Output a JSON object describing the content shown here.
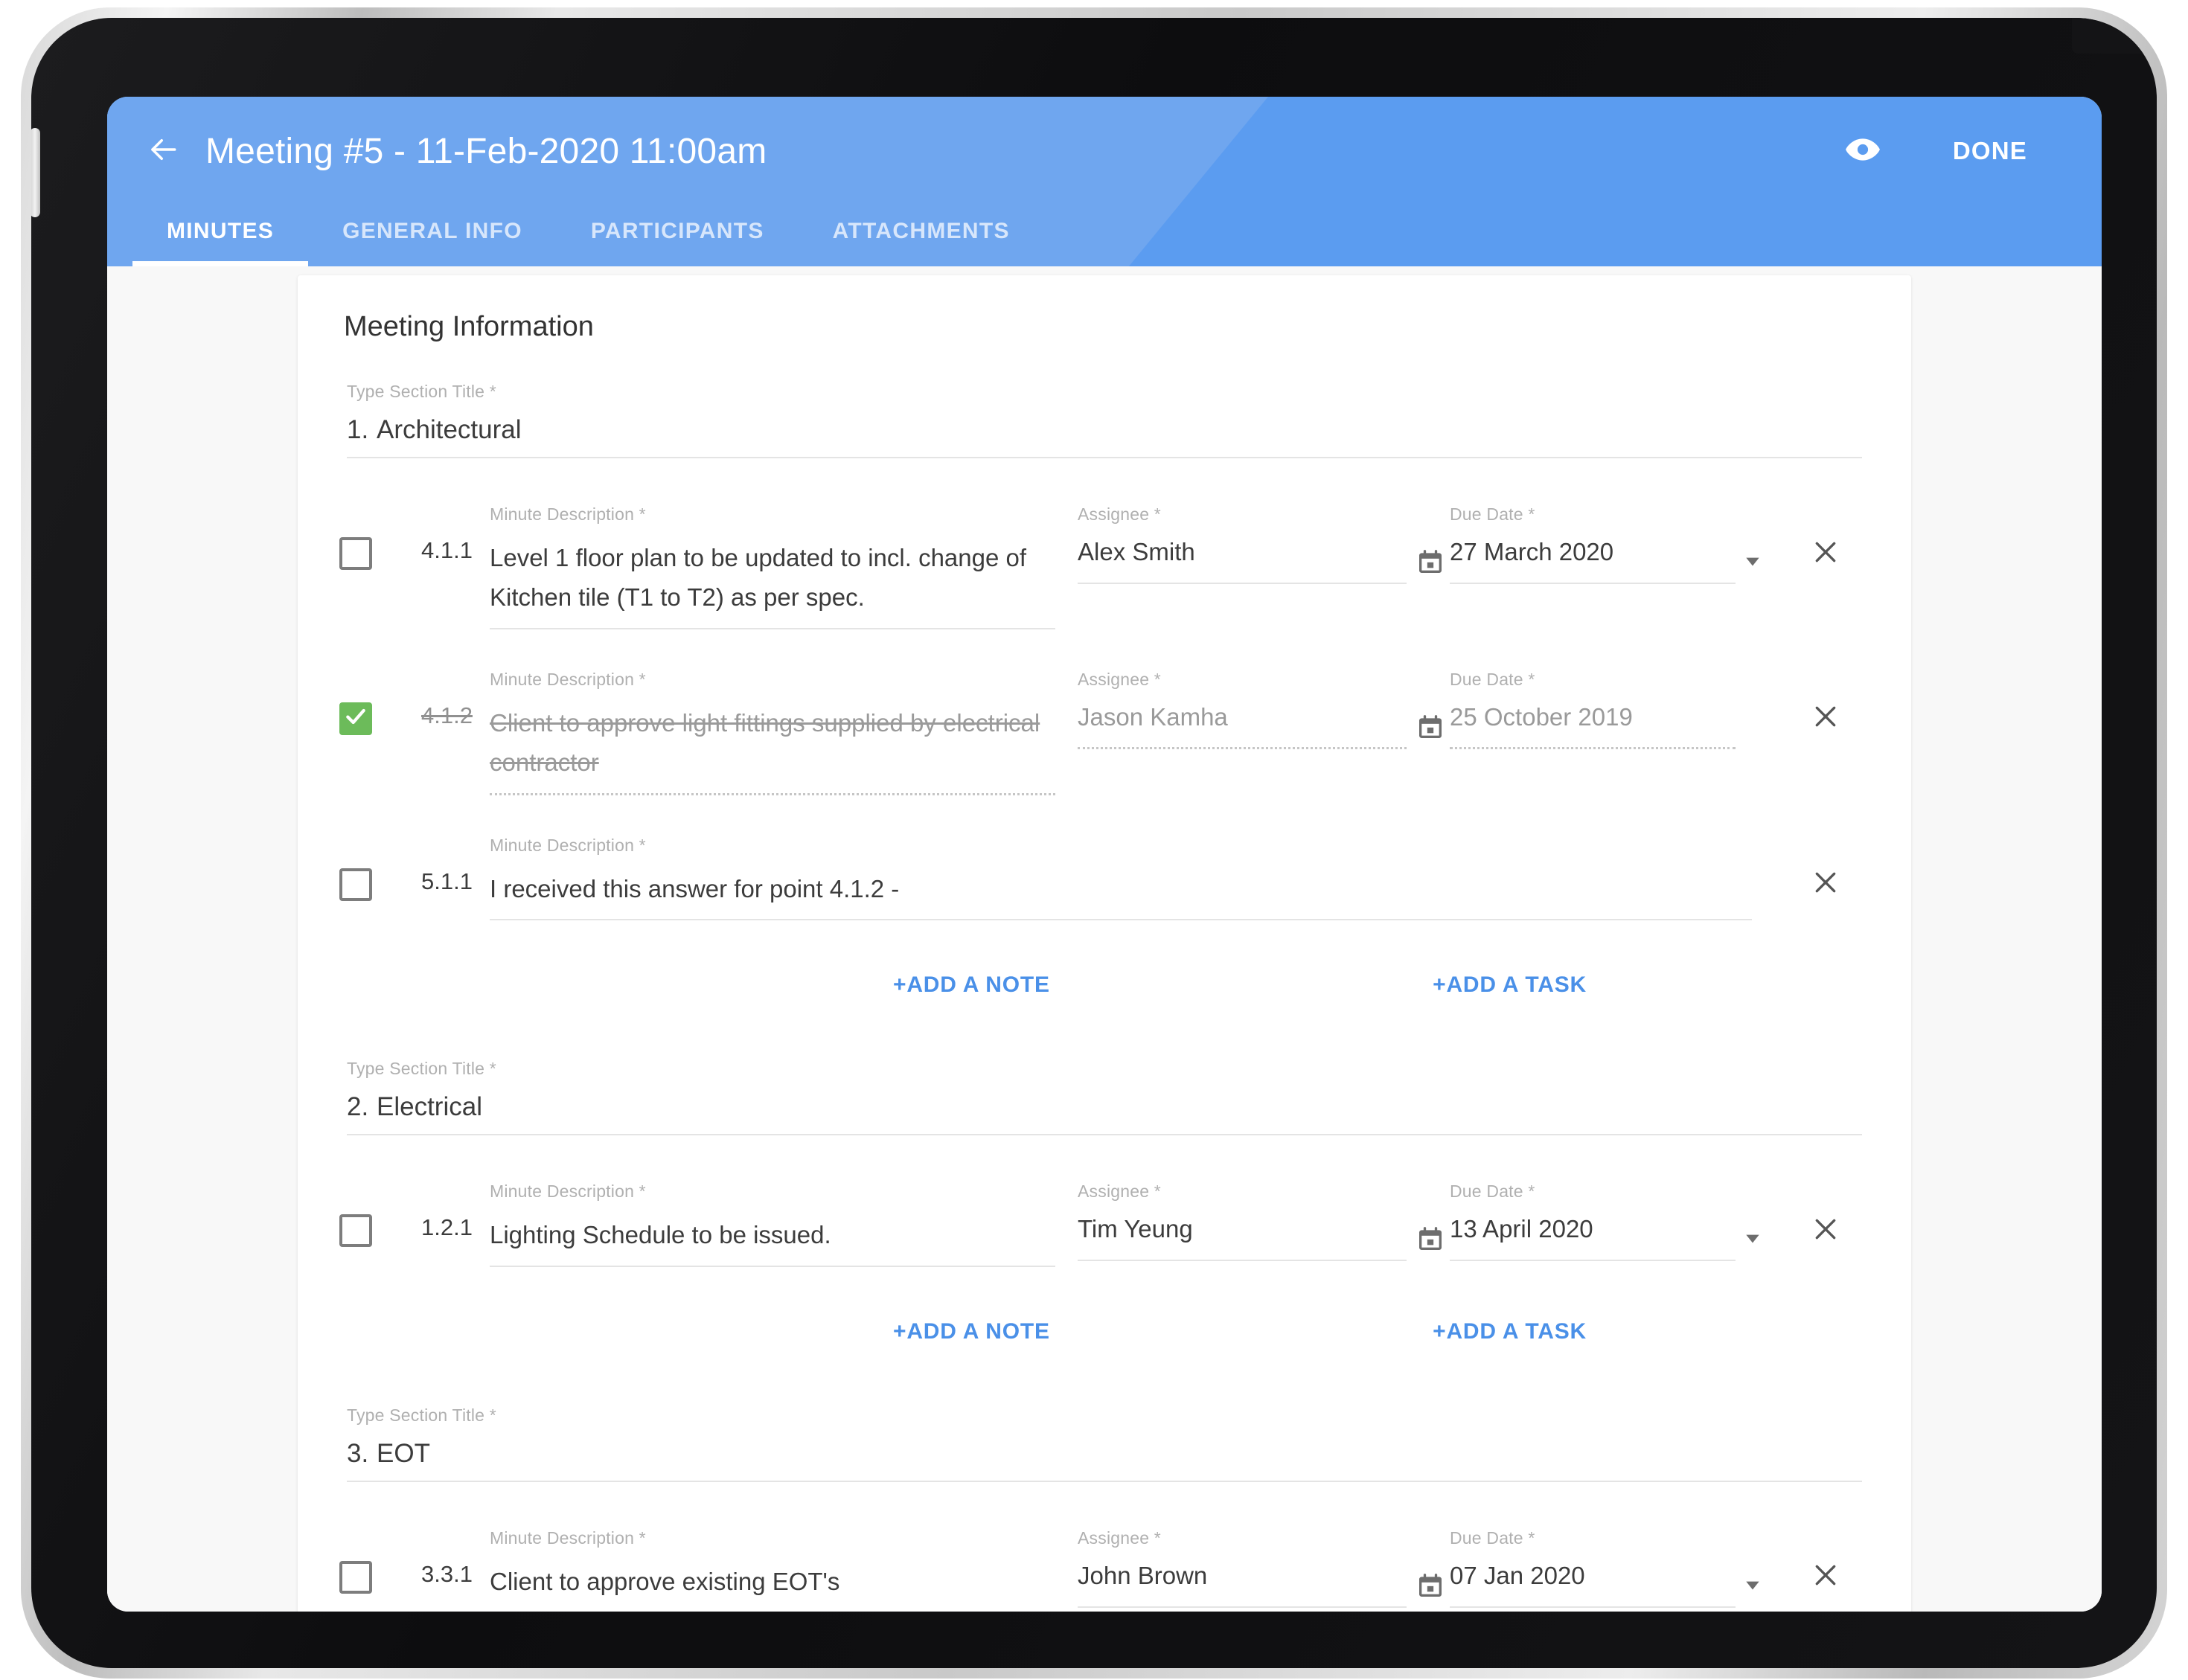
{
  "app_bar": {
    "back_icon": "arrow-left-icon",
    "title": "Meeting #5 - 11-Feb-2020 11:00am",
    "preview_icon": "eye-icon",
    "done_label": "DONE",
    "accent_color": "#5b9cf0",
    "accent_color_light": "#6fa6ef"
  },
  "tabs": [
    {
      "label": "MINUTES",
      "active": true
    },
    {
      "label": "GENERAL INFO",
      "active": false
    },
    {
      "label": "PARTICIPANTS",
      "active": false
    },
    {
      "label": "ATTACHMENTS",
      "active": false
    }
  ],
  "card": {
    "heading": "Meeting Information",
    "section_title_label": "Type Section Title *",
    "minute_description_label": "Minute Description *",
    "assignee_label": "Assignee *",
    "due_date_label": "Due Date *",
    "add_note_label": "+ADD A NOTE",
    "add_task_label": "+ADD A TASK",
    "checked_color": "#6cbb5a",
    "link_color": "#4a90e8"
  },
  "sections": [
    {
      "number": "1.",
      "title": "Architectural",
      "has_add_actions": true,
      "rows": [
        {
          "index": "4.1.1",
          "description": "Level 1 floor plan to be updated to incl. change of Kitchen tile (T1 to T2) as per spec.",
          "assignee": "Alex Smith",
          "due_date": "27 March 2020",
          "checked": false,
          "type": "task"
        },
        {
          "index": "4.1.2",
          "description": "Client to approve light fittings supplied by electrical contractor",
          "assignee": "Jason Kamha",
          "due_date": "25 October 2019",
          "checked": true,
          "type": "task"
        },
        {
          "index": "5.1.1",
          "description": "I received this answer for point 4.1.2 -",
          "assignee": "",
          "due_date": "",
          "checked": false,
          "type": "note"
        }
      ]
    },
    {
      "number": "2.",
      "title": "Electrical",
      "has_add_actions": true,
      "rows": [
        {
          "index": "1.2.1",
          "description": "Lighting Schedule to be issued.",
          "assignee": "Tim Yeung",
          "due_date": "13 April 2020",
          "checked": false,
          "type": "task"
        }
      ]
    },
    {
      "number": "3.",
      "title": "EOT",
      "has_add_actions": false,
      "rows": [
        {
          "index": "3.3.1",
          "description": "Client to approve existing EOT's",
          "assignee": "John Brown",
          "due_date": "07 Jan 2020",
          "checked": false,
          "type": "task"
        }
      ]
    }
  ]
}
